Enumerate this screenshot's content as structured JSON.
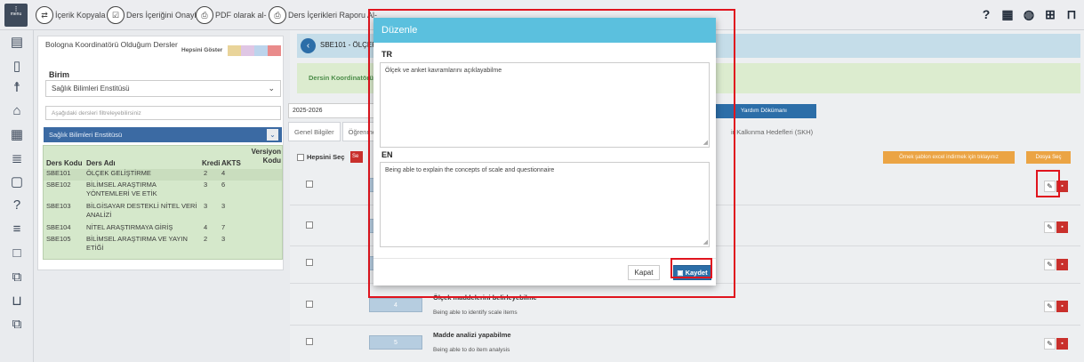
{
  "toolbar": {
    "menu_label": "menu",
    "buttons": [
      {
        "label": "İçerik Kopyala",
        "icon": "swap-icon"
      },
      {
        "label": "Ders İçeriğini Onayla",
        "icon": "approve-icon"
      },
      {
        "label": "PDF olarak al-",
        "icon": "print-icon"
      },
      {
        "label": "Ders İçerikleri Raporu Al-",
        "icon": "print-icon"
      }
    ],
    "right_icons": [
      "help-icon",
      "calendar-icon",
      "globe-icon",
      "grid-icon",
      "lock-icon"
    ]
  },
  "left_panel": {
    "title": "Bologna Koordinatörü Olduğum Dersler",
    "show_all": "Hepsini Göster",
    "swatch_colors": [
      "#e9d49a",
      "#dfc6e4",
      "#bcd4ec",
      "#e98b8b"
    ],
    "birim_label": "Birim",
    "birim_value": "Sağlık Bilimleri Enstitüsü",
    "filter_placeholder": "Aşağıdaki dersleri filtreleyebilirsiniz",
    "institute_bar": "Sağlık Bilimleri Enstitüsü",
    "columns": {
      "code": "Ders Kodu",
      "name": "Ders Adı",
      "credit": "Kredi",
      "ects": "AKTS",
      "version": "Versiyon Kodu"
    },
    "courses": [
      {
        "code": "SBE101",
        "name": "ÖLÇEK GELİŞTİRME",
        "credit": "2",
        "ects": "4"
      },
      {
        "code": "SBE102",
        "name": "BİLİMSEL ARAŞTIRMA YÖNTEMLERİ VE ETİK",
        "credit": "3",
        "ects": "6"
      },
      {
        "code": "SBE103",
        "name": "BİLGİSAYAR DESTEKLİ NİTEL VERİ ANALİZİ",
        "credit": "3",
        "ects": "3"
      },
      {
        "code": "SBE104",
        "name": "NİTEL ARAŞTIRMAYA GİRİŞ",
        "credit": "4",
        "ects": "7"
      },
      {
        "code": "SBE105",
        "name": "BİLİMSEL ARAŞTIRMA VE YAYIN ETİĞİ",
        "credit": "2",
        "ects": "3"
      }
    ]
  },
  "content": {
    "breadcrumb": "SBE101 - ÖLÇEK",
    "coordinator": "Dersin Koordinatörü:",
    "year": "2025-2026",
    "help_doc": "Yardım Dökümanı",
    "tabs": [
      "Genel Bilgiler",
      "Öğrenme"
    ],
    "tab_right": "ir Kalkınma Hedefleri (SKH)",
    "select_all": "Hepsini Seç",
    "delete_short": "Se",
    "excel_hint": "Örnek şablon excel indirmek için tıklayınız",
    "file_select": "Dosya Seç",
    "rows": [
      {
        "num": "",
        "tr": "",
        "en": ""
      },
      {
        "num": "",
        "tr": "",
        "en": ""
      },
      {
        "num": "",
        "tr": "",
        "en": ""
      },
      {
        "num": "4",
        "tr": "Ölçek maddelerini belirleyebilme",
        "en": "Being able to identify scale items"
      },
      {
        "num": "5",
        "tr": "Madde analizi yapabilme",
        "en": "Being able to do item analysis"
      }
    ]
  },
  "modal": {
    "title": "Düzenle",
    "tr_label": "TR",
    "tr_value": "Ölçek ve anket kavramlarını açıklayabilme",
    "en_label": "EN",
    "en_value": "Being able to explain the concepts of scale and questionnaire",
    "close": "Kapat",
    "save": "Kaydet"
  },
  "colors": {
    "modal_header": "#5bc0de",
    "primary": "#2c6ea8",
    "highlight": "#e0141e",
    "danger": "#c9302c",
    "warning": "#eba444"
  }
}
